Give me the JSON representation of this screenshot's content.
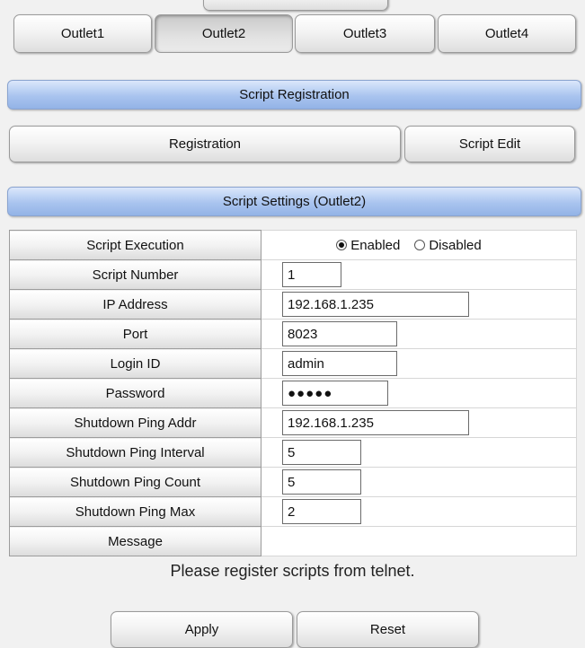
{
  "outlet_tabs": [
    "Outlet1",
    "Outlet2",
    "Outlet3",
    "Outlet4"
  ],
  "active_tab": "Outlet2",
  "script_registration": {
    "header": "Script Registration",
    "registration_label": "Registration",
    "script_edit_label": "Script Edit"
  },
  "settings": {
    "header": "Script Settings (Outlet2)",
    "script_execution": {
      "label": "Script Execution",
      "options": [
        "Enabled",
        "Disabled"
      ],
      "selected": "Enabled"
    },
    "script_number": {
      "label": "Script Number",
      "value": "1"
    },
    "ip_address": {
      "label": "IP Address",
      "value": "192.168.1.235"
    },
    "port": {
      "label": "Port",
      "value": "8023"
    },
    "login_id": {
      "label": "Login ID",
      "value": "admin"
    },
    "password": {
      "label": "Password",
      "value": "●●●●●"
    },
    "shutdown_ping_addr": {
      "label": "Shutdown Ping Addr",
      "value": "192.168.1.235"
    },
    "shutdown_ping_interval": {
      "label": "Shutdown Ping Interval",
      "value": "5"
    },
    "shutdown_ping_count": {
      "label": "Shutdown Ping Count",
      "value": "5"
    },
    "shutdown_ping_max": {
      "label": "Shutdown Ping Max",
      "value": "2"
    },
    "message": {
      "label": "Message",
      "value": ""
    }
  },
  "message_text": "Please register scripts from telnet.",
  "actions": {
    "apply_label": "Apply",
    "reset_label": "Reset"
  }
}
